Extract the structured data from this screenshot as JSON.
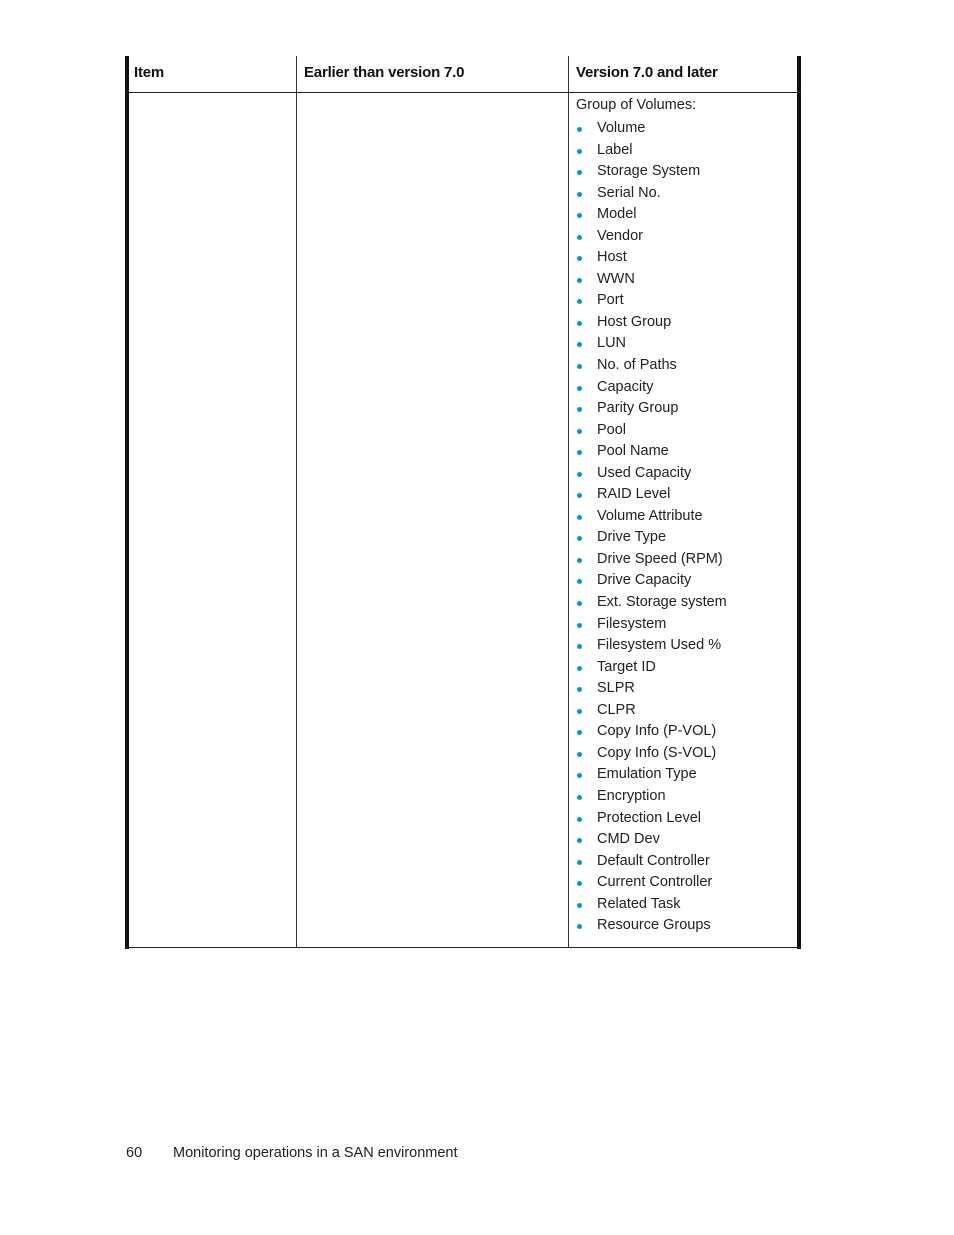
{
  "table": {
    "headers": [
      "Item",
      "Earlier than version 7.0",
      "Version 7.0 and later"
    ],
    "rows": [
      {
        "item": "",
        "earlier": "",
        "later": {
          "group_title": "Group of Volumes:",
          "items": [
            "Volume",
            "Label",
            "Storage System",
            "Serial No.",
            "Model",
            "Vendor",
            "Host",
            "WWN",
            "Port",
            "Host Group",
            "LUN",
            "No. of Paths",
            "Capacity",
            "Parity Group",
            "Pool",
            "Pool Name",
            "Used Capacity",
            "RAID Level",
            "Volume Attribute",
            "Drive Type",
            "Drive Speed (RPM)",
            "Drive Capacity",
            "Ext. Storage system",
            "Filesystem",
            "Filesystem Used %",
            "Target ID",
            "SLPR",
            "CLPR",
            "Copy Info (P-VOL)",
            "Copy Info (S-VOL)",
            "Emulation Type",
            "Encryption",
            "Protection Level",
            "CMD Dev",
            "Default Controller",
            "Current Controller",
            "Related Task",
            "Resource Groups"
          ]
        }
      }
    ]
  },
  "footer": {
    "page_number": "60",
    "section_title": "Monitoring operations in a SAN environment"
  },
  "colors": {
    "bullet": "#0096d6"
  }
}
